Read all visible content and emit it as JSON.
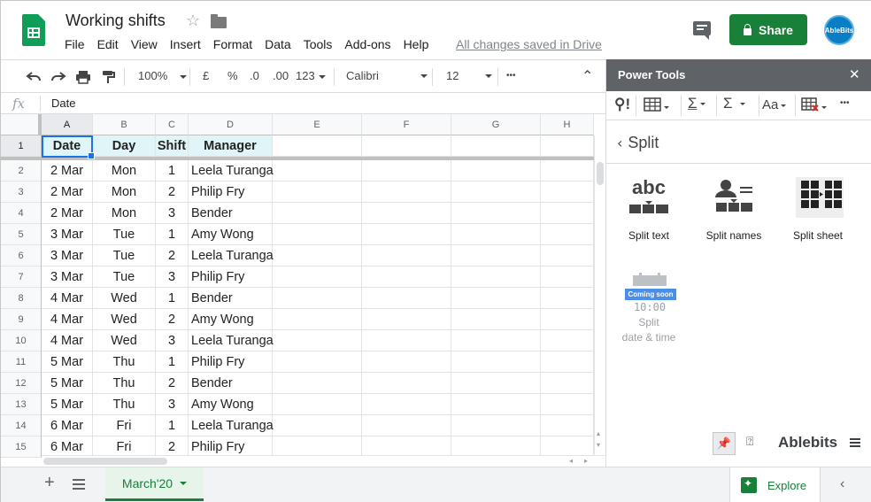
{
  "app": {
    "doc_title": "Working shifts",
    "menu": [
      "File",
      "Edit",
      "View",
      "Insert",
      "Format",
      "Data",
      "Tools",
      "Add-ons",
      "Help"
    ],
    "saved_status": "All changes saved in Drive",
    "share_label": "Share",
    "avatar_text": "AbleBits",
    "brand_color": "#188038"
  },
  "toolbar": {
    "zoom": "100%",
    "currency": "£",
    "percent": "%",
    "dec_decrease": ".0",
    "dec_increase": ".00",
    "format_more": "123",
    "font": "Calibri",
    "font_size": "12",
    "more": "•••",
    "collapse": "⌃"
  },
  "formula_bar": {
    "fx": "fx",
    "value": "Date"
  },
  "grid": {
    "columns": [
      "A",
      "B",
      "C",
      "D",
      "E",
      "F",
      "G",
      "H"
    ],
    "header_row": {
      "num": "1",
      "cells": [
        "Date",
        "Day",
        "Shift",
        "Manager"
      ]
    },
    "rows": [
      {
        "num": "2",
        "cells": [
          "2 Mar",
          "Mon",
          "1",
          "Leela Turanga"
        ]
      },
      {
        "num": "3",
        "cells": [
          "2 Mar",
          "Mon",
          "2",
          "Philip Fry"
        ]
      },
      {
        "num": "4",
        "cells": [
          "2 Mar",
          "Mon",
          "3",
          "Bender"
        ]
      },
      {
        "num": "5",
        "cells": [
          "3 Mar",
          "Tue",
          "1",
          "Amy Wong"
        ]
      },
      {
        "num": "6",
        "cells": [
          "3 Mar",
          "Tue",
          "2",
          "Leela Turanga"
        ]
      },
      {
        "num": "7",
        "cells": [
          "3 Mar",
          "Tue",
          "3",
          "Philip Fry"
        ]
      },
      {
        "num": "8",
        "cells": [
          "4 Mar",
          "Wed",
          "1",
          "Bender"
        ]
      },
      {
        "num": "9",
        "cells": [
          "4 Mar",
          "Wed",
          "2",
          "Amy Wong"
        ]
      },
      {
        "num": "10",
        "cells": [
          "4 Mar",
          "Wed",
          "3",
          "Leela Turanga"
        ]
      },
      {
        "num": "11",
        "cells": [
          "5 Mar",
          "Thu",
          "1",
          "Philip Fry"
        ]
      },
      {
        "num": "12",
        "cells": [
          "5 Mar",
          "Thu",
          "2",
          "Bender"
        ]
      },
      {
        "num": "13",
        "cells": [
          "5 Mar",
          "Thu",
          "3",
          "Amy Wong"
        ]
      },
      {
        "num": "14",
        "cells": [
          "6 Mar",
          "Fri",
          "1",
          "Leela Turanga"
        ]
      },
      {
        "num": "15",
        "cells": [
          "6 Mar",
          "Fri",
          "2",
          "Philip Fry"
        ]
      }
    ],
    "header_fill": "#dff5f8",
    "selection_color": "#1a73e8"
  },
  "sheets": {
    "active_tab": "March'20",
    "explore_label": "Explore"
  },
  "power_tools": {
    "title": "Power Tools",
    "close": "✕",
    "section": "Split",
    "tools": [
      {
        "label": "Split text",
        "enabled": true
      },
      {
        "label": "Split names",
        "enabled": true
      },
      {
        "label": "Split sheet",
        "enabled": true
      },
      {
        "label_line1": "Split",
        "label_line2": "date & time",
        "enabled": false,
        "badge": "Coming soon"
      }
    ],
    "brand": "Ablebits"
  }
}
